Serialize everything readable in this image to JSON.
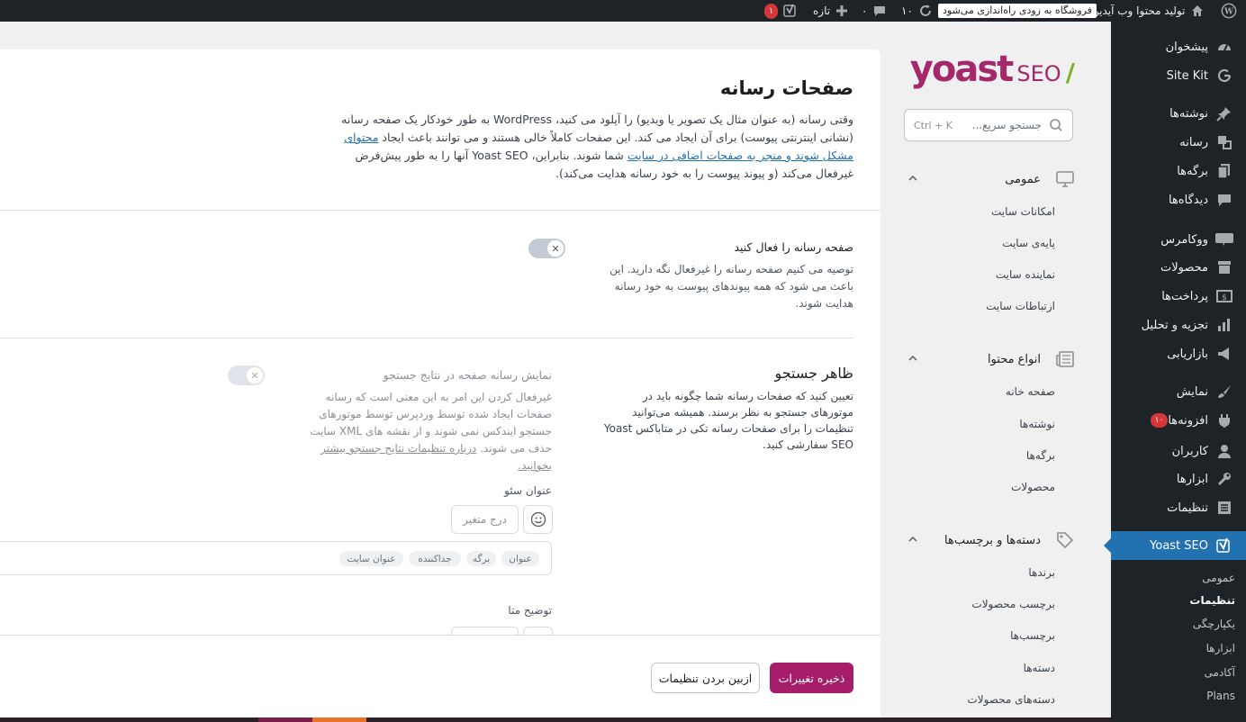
{
  "admin_bar": {
    "site_name": "تولید محتوا وب آیدین",
    "store_notice": "فروشگاه به زودی راه‌اندازی می‌شود",
    "updates_count": "۱۰",
    "comments_count": "۰",
    "new_label": "تازه",
    "yoast_badge": "۱"
  },
  "admin_menu": {
    "items": [
      {
        "label": "پیشخوان",
        "icon": "dashboard-icon"
      },
      {
        "label": "Site Kit",
        "icon": "google-icon"
      },
      {
        "label": "نوشته‌ها",
        "icon": "pin-icon"
      },
      {
        "label": "رسانه",
        "icon": "media-icon"
      },
      {
        "label": "برگه‌ها",
        "icon": "pages-icon"
      },
      {
        "label": "دیدگاه‌ها",
        "icon": "comment-icon"
      },
      {
        "label": "ووکامرس",
        "icon": "woocommerce-icon"
      },
      {
        "label": "محصولات",
        "icon": "products-icon"
      },
      {
        "label": "پرداخت‌ها",
        "icon": "payments-icon"
      },
      {
        "label": "تجزیه و تحلیل",
        "icon": "analytics-icon"
      },
      {
        "label": "بازاریابی",
        "icon": "megaphone-icon"
      },
      {
        "label": "نمایش",
        "icon": "brush-icon"
      },
      {
        "label": "افزونه‌ها",
        "icon": "plugin-icon",
        "badge": "۱۰"
      },
      {
        "label": "کاربران",
        "icon": "users-icon"
      },
      {
        "label": "ابزارها",
        "icon": "wrench-icon"
      },
      {
        "label": "تنظیمات",
        "icon": "settings-icon"
      }
    ],
    "current": {
      "label": "Yoast SEO",
      "icon": "yoast-icon"
    },
    "submenu": [
      "عمومی",
      "تنظیمات",
      "یکپارچگی",
      "ابزارها",
      "آکادمی",
      "Plans"
    ]
  },
  "yoast_nav": {
    "logo_text": "yoast",
    "logo_seo": "SEO",
    "logo_slash": "/",
    "search_placeholder": "جستجو سریع...",
    "search_shortcut": "Ctrl + K",
    "groups": [
      {
        "label": "عمومی",
        "icon": "monitor-icon",
        "items": [
          "امکانات سایت",
          "پایه‌ی سایت",
          "نماینده سایت",
          "ارتباطات سایت"
        ]
      },
      {
        "label": "انواع محتوا",
        "icon": "newspaper-icon",
        "items": [
          "صفحه خانه",
          "نوشته‌ها",
          "برگه‌ها",
          "محصولات"
        ]
      },
      {
        "label": "دسته‌ها و برچسب‌ها",
        "icon": "tag-icon",
        "items": [
          "برندها",
          "برچسب محصولات",
          "برچسب‌ها",
          "دسته‌ها",
          "دسته‌های محصولات"
        ]
      }
    ]
  },
  "main": {
    "title": "صفحات رسانه",
    "intro_part1": "وقتی رسانه (به عنوان مثال یک تصویر یا ویدیو) را آپلود می کنید، WordPress به طور خودکار یک صفحه رسانه (نشانی اینترنتی پیوست) برای آن ایجاد می کند. این صفحات کاملاً خالی هستند و می توانند باعث ایجاد ",
    "intro_link": "محتوای مشکل شوند و منجر به صفحات اضافی در سایت",
    "intro_part2": " شما شوند. بنابراین، Yoast SEO آنها را به طور پیش‌فرض غیرفعال می‌کند (و پیوند پیوست را به خود رسانه هدایت می‌کند).",
    "enable_label": "صفحه رسانه را فعال کنید",
    "enable_desc": "توصیه می کنیم صفحه رسانه را غیرفعال نگه دارید. این باعث می شود که همه پیوندهای پیوست به خود رسانه هدایت شوند.",
    "search_appearance_title": "ظاهر جستجو",
    "search_appearance_desc": "تعیین کنید که صفحات رسانه شما چگونه باید در موتورهای جستجو به نظر برسند. همیشه می‌توانید تنظیمات را برای صفحات رسانه تکی در متاباکس Yoast SEO سفارشی کنید.",
    "show_in_results_label": "نمایش رسانه صفحه در نتایج جستجو",
    "show_in_results_desc": "غیرفعال کردن این امر به این معنی است که رسانه صفحات ایجاد شده توسط وردپرس توسط موتورهای جستجو ایندکس نمی شوند و از نقشه های XML سایت حذف می شوند.",
    "show_in_results_link": "درباره تنظیمات نتایج جستجو بیشتر بخوانید.",
    "seo_title_label": "عنوان سئو",
    "insert_variable": "درج متغیر",
    "tags": [
      "عنوان",
      "برگه",
      "جداکننده",
      "عنوان سایت"
    ],
    "meta_desc_label": "توضیح متا"
  },
  "footer": {
    "save_label": "ذخیره تغییرات",
    "discard_label": "ازبین بردن تنظیمات"
  },
  "colors": {
    "brand": "#a61e69",
    "admin_bg": "#1d2327",
    "wp_blue": "#2271b1"
  }
}
